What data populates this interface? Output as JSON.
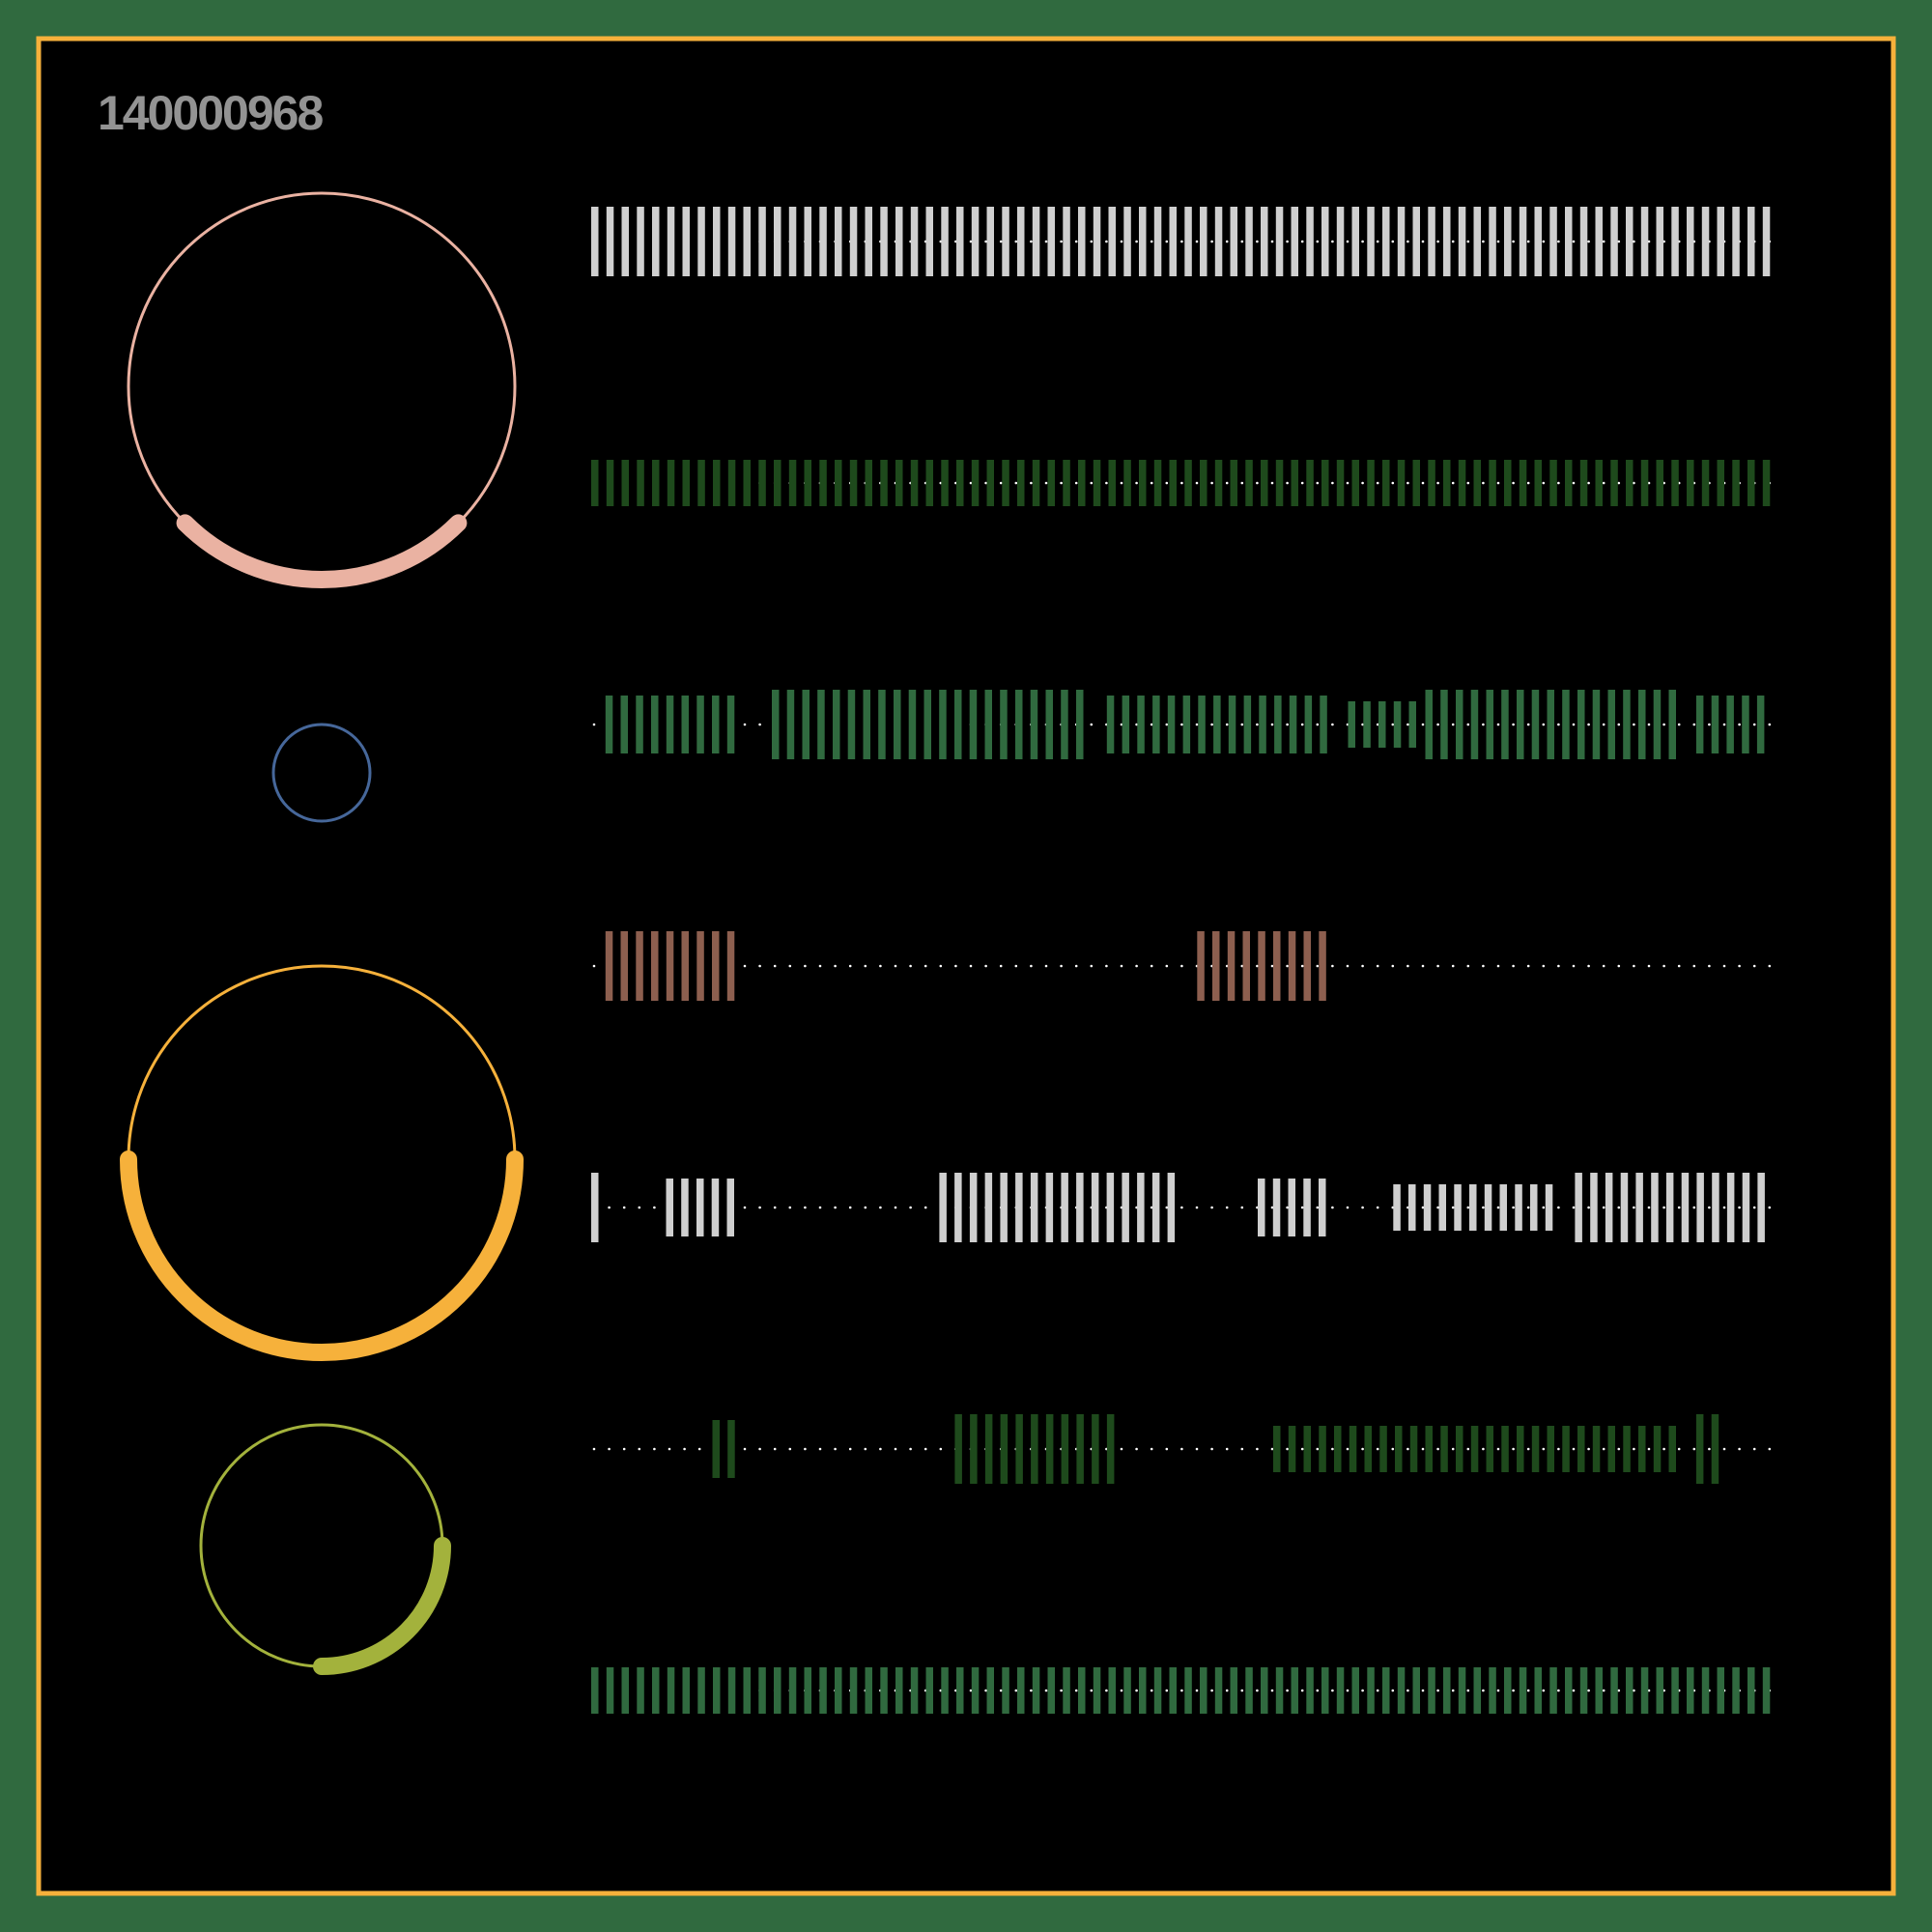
{
  "label": "140000968",
  "colors": {
    "outer_background": "#306a3f",
    "frame_border": "#f6b13b",
    "canvas_background": "#000000",
    "label": "#939393",
    "dots": "#ffffff"
  },
  "rings": [
    {
      "color": "#eab2a2",
      "size": "large",
      "arc_fraction": 0.25,
      "arc_start_deg": 45
    },
    {
      "color": "#46679a",
      "size": "small",
      "arc_fraction": 0.0,
      "arc_start_deg": 0
    },
    {
      "color": "#f6b13b",
      "size": "large",
      "arc_fraction": 0.5,
      "arc_start_deg": 90
    },
    {
      "color": "#a3b23c",
      "size": "medium",
      "arc_fraction": 0.25,
      "arc_start_deg": 90
    }
  ],
  "rows": [
    {
      "color": "#cfcfcf",
      "segments": [
        {
          "from": 0.0,
          "to": 1.0,
          "height": "tall"
        }
      ]
    },
    {
      "color": "#1e4a1c",
      "segments": [
        {
          "from": 0.0,
          "to": 1.0,
          "height": "short"
        }
      ]
    },
    {
      "color": "#306a3f",
      "segments": [
        {
          "from": 0.012,
          "to": 0.122,
          "height": "medium"
        },
        {
          "from": 0.152,
          "to": 0.427,
          "height": "tall"
        },
        {
          "from": 0.434,
          "to": 0.63,
          "height": "medium"
        },
        {
          "from": 0.637,
          "to": 0.7,
          "height": "short"
        },
        {
          "from": 0.702,
          "to": 0.925,
          "height": "tall"
        },
        {
          "from": 0.93,
          "to": 1.0,
          "height": "medium"
        }
      ]
    },
    {
      "color": "#8d5f4f",
      "segments": [
        {
          "from": 0.012,
          "to": 0.122,
          "height": "tall"
        },
        {
          "from": 0.51,
          "to": 0.63,
          "height": "tall"
        }
      ]
    },
    {
      "color": "#cfcfcf",
      "segments": [
        {
          "from": 0.0,
          "to": 0.006,
          "height": "tall"
        },
        {
          "from": 0.063,
          "to": 0.122,
          "height": "medium"
        },
        {
          "from": 0.293,
          "to": 0.504,
          "height": "tall"
        },
        {
          "from": 0.561,
          "to": 0.63,
          "height": "medium"
        },
        {
          "from": 0.675,
          "to": 0.82,
          "height": "short"
        },
        {
          "from": 0.828,
          "to": 1.0,
          "height": "tall"
        }
      ]
    },
    {
      "color": "#1e4a1c",
      "segments": [
        {
          "from": 0.102,
          "to": 0.122,
          "height": "medium"
        },
        {
          "from": 0.306,
          "to": 0.452,
          "height": "tall"
        },
        {
          "from": 0.574,
          "to": 0.92,
          "height": "short"
        },
        {
          "from": 0.93,
          "to": 0.952,
          "height": "tall"
        }
      ]
    },
    {
      "color": "#306a3f",
      "segments": [
        {
          "from": 0.0,
          "to": 1.0,
          "height": "short"
        }
      ]
    }
  ]
}
